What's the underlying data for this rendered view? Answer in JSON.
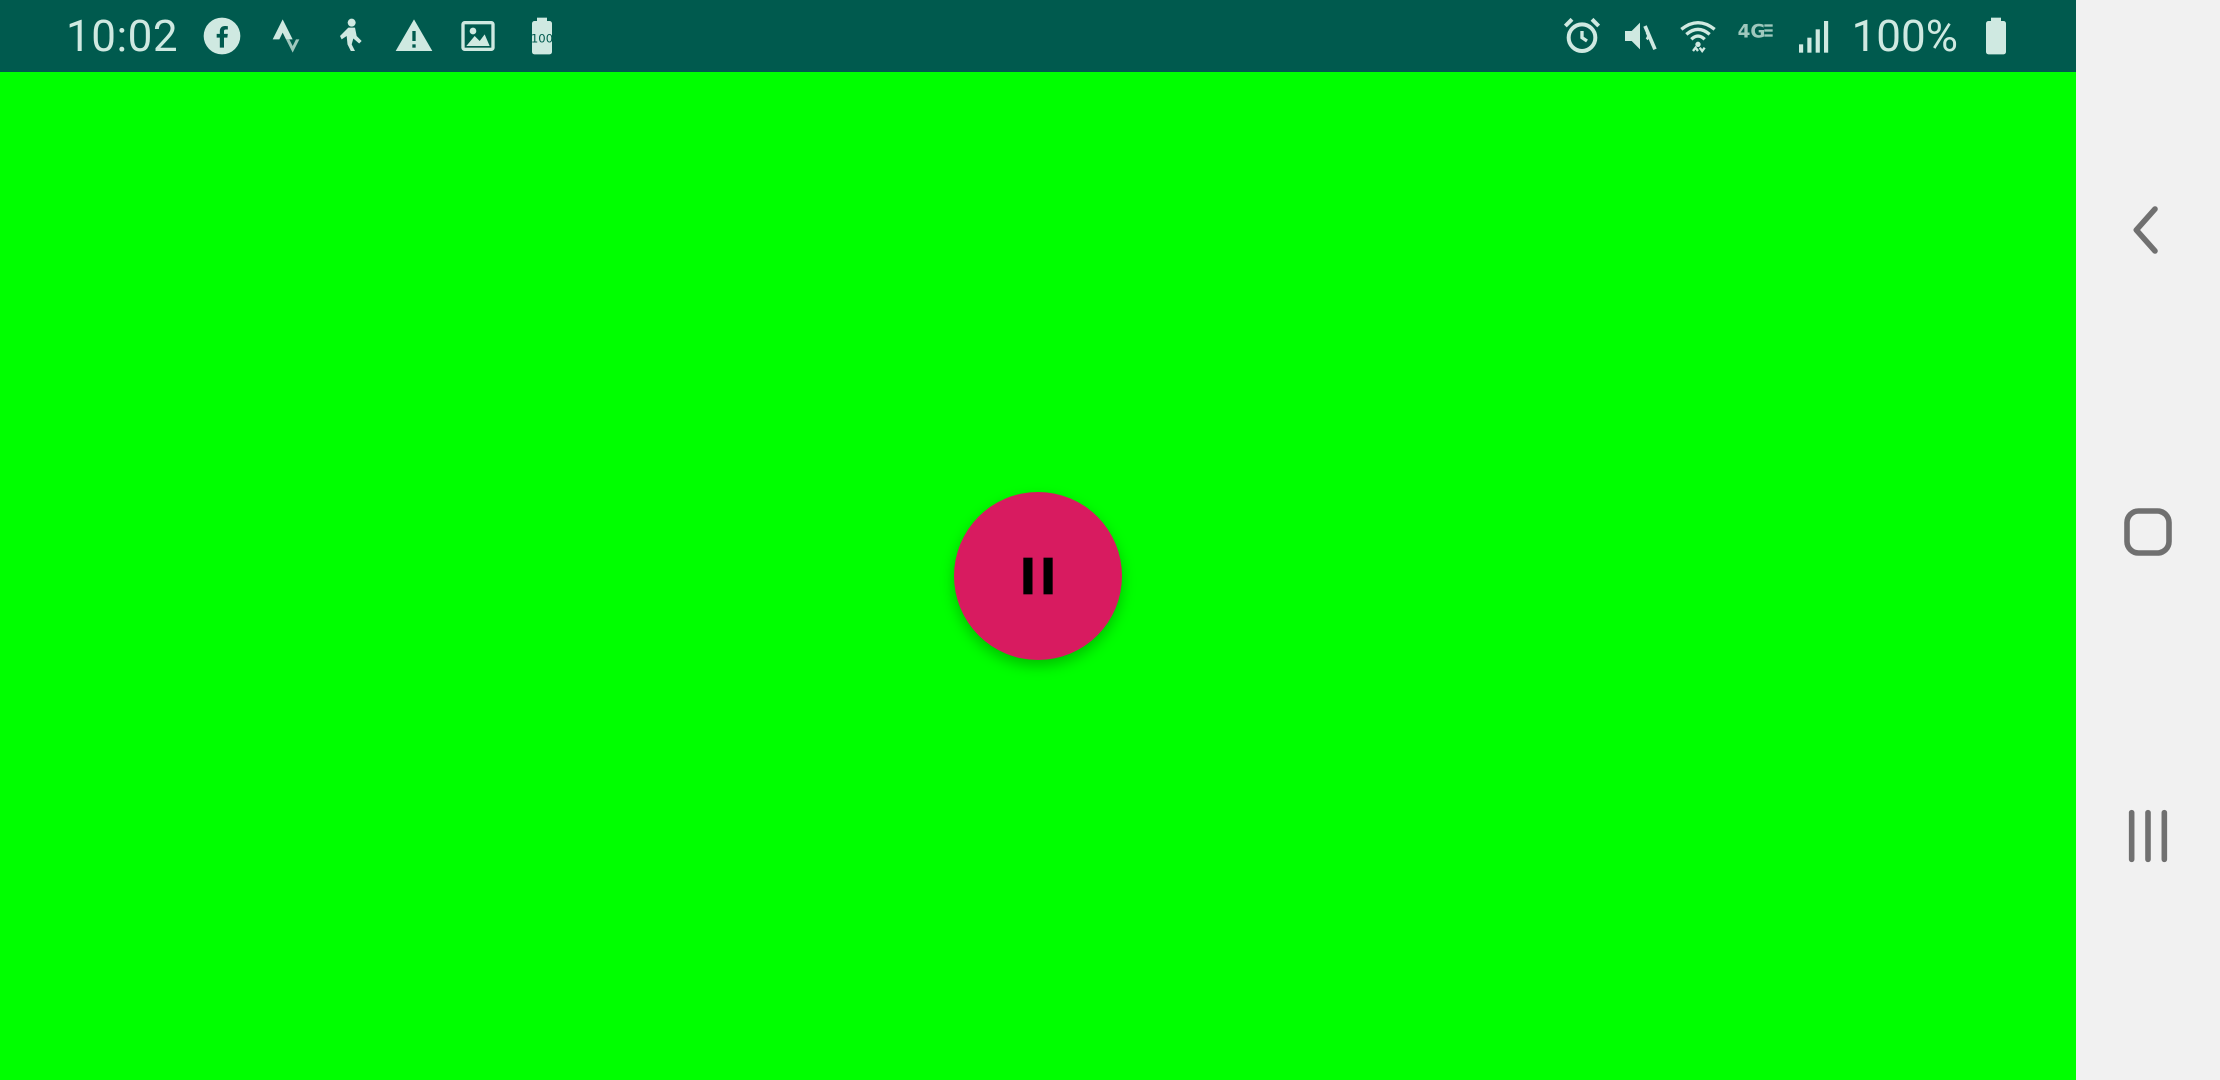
{
  "status_bar": {
    "time": "10:02",
    "left_icons": [
      "facebook-icon",
      "strava-icon",
      "figure-icon",
      "warning-icon",
      "image-icon",
      "battery-100-icon"
    ],
    "right_icons": [
      "alarm-icon",
      "muted-icon",
      "wifi-icon",
      "4g-icon",
      "signal-icon"
    ],
    "battery_percent": "100%",
    "background_color": "#005a4e",
    "text_color": "#cfe9e1"
  },
  "screen": {
    "background_color": "#00ff00"
  },
  "fab": {
    "icon": "pause-icon",
    "color": "#d81b60"
  },
  "nav_bar": {
    "background_color": "#f1f1f1",
    "buttons": [
      "back",
      "home",
      "recents"
    ]
  }
}
